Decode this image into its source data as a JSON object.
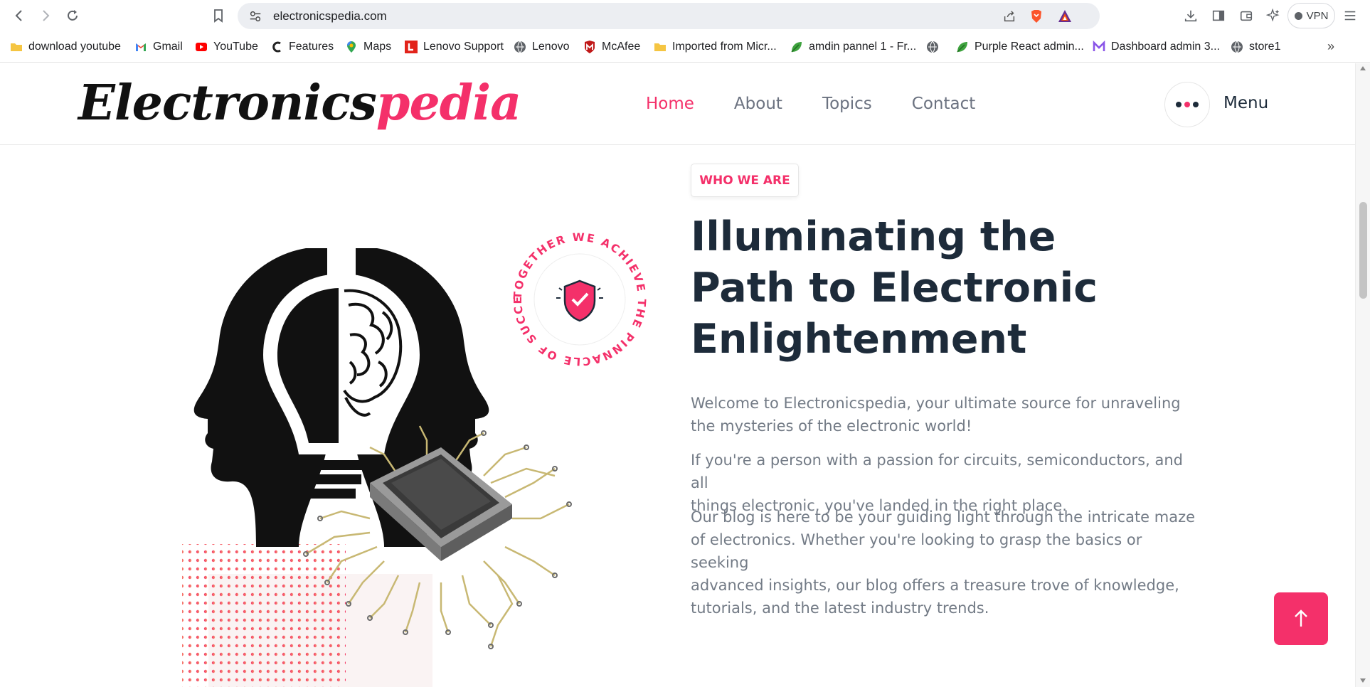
{
  "browser": {
    "url": "electronicspedia.com",
    "vpn_label": "VPN",
    "bookmarks": [
      {
        "label": "download youtube",
        "icon": "folder-icon"
      },
      {
        "label": "Gmail",
        "icon": "gmail-icon"
      },
      {
        "label": "YouTube",
        "icon": "youtube-icon"
      },
      {
        "label": "Features",
        "icon": "c-logo-icon"
      },
      {
        "label": "Maps",
        "icon": "maps-pin-icon"
      },
      {
        "label": "Lenovo Support",
        "icon": "lenovo-l-icon"
      },
      {
        "label": "Lenovo",
        "icon": "globe-icon"
      },
      {
        "label": "McAfee",
        "icon": "mcafee-icon"
      },
      {
        "label": "Imported from Micr...",
        "icon": "folder-icon"
      },
      {
        "label": "amdin pannel 1 - Fr...",
        "icon": "leaf-icon"
      },
      {
        "label": "",
        "icon": "globe-icon"
      },
      {
        "label": "Purple React admin...",
        "icon": "leaf-icon"
      },
      {
        "label": "Dashboard admin 3...",
        "icon": "m-logo-icon"
      },
      {
        "label": "store1",
        "icon": "globe-icon"
      }
    ]
  },
  "site": {
    "logo_part1": "Electronics",
    "logo_part2": "pedia",
    "nav": [
      "Home",
      "About",
      "Topics",
      "Contact"
    ],
    "active_nav": "Home",
    "menu_label": "Menu"
  },
  "hero": {
    "badge": "WHO WE ARE",
    "headline_lines": [
      "Illuminating the",
      "Path to Electronic",
      "Enlightenment"
    ],
    "circle_text": "TOGETHER WE ACHIEVE THE PINNACLE OF SUCCESS",
    "paragraphs": [
      [
        "Welcome to Electronicspedia, your ultimate source for unraveling",
        "the mysteries of the electronic world!"
      ],
      [
        "If you're a person with a passion for circuits, semiconductors, and all",
        "things electronic, you've landed in the right place."
      ],
      [
        "Our blog is here to be your guiding light through the intricate maze",
        "of electronics. Whether you're looking to grasp the basics or seeking",
        "advanced insights, our blog offers a treasure trove of knowledge,",
        "tutorials, and the latest industry trends."
      ]
    ]
  },
  "colors": {
    "accent": "#f4306a",
    "heading": "#1d2b3a",
    "body_text": "#737b86"
  }
}
